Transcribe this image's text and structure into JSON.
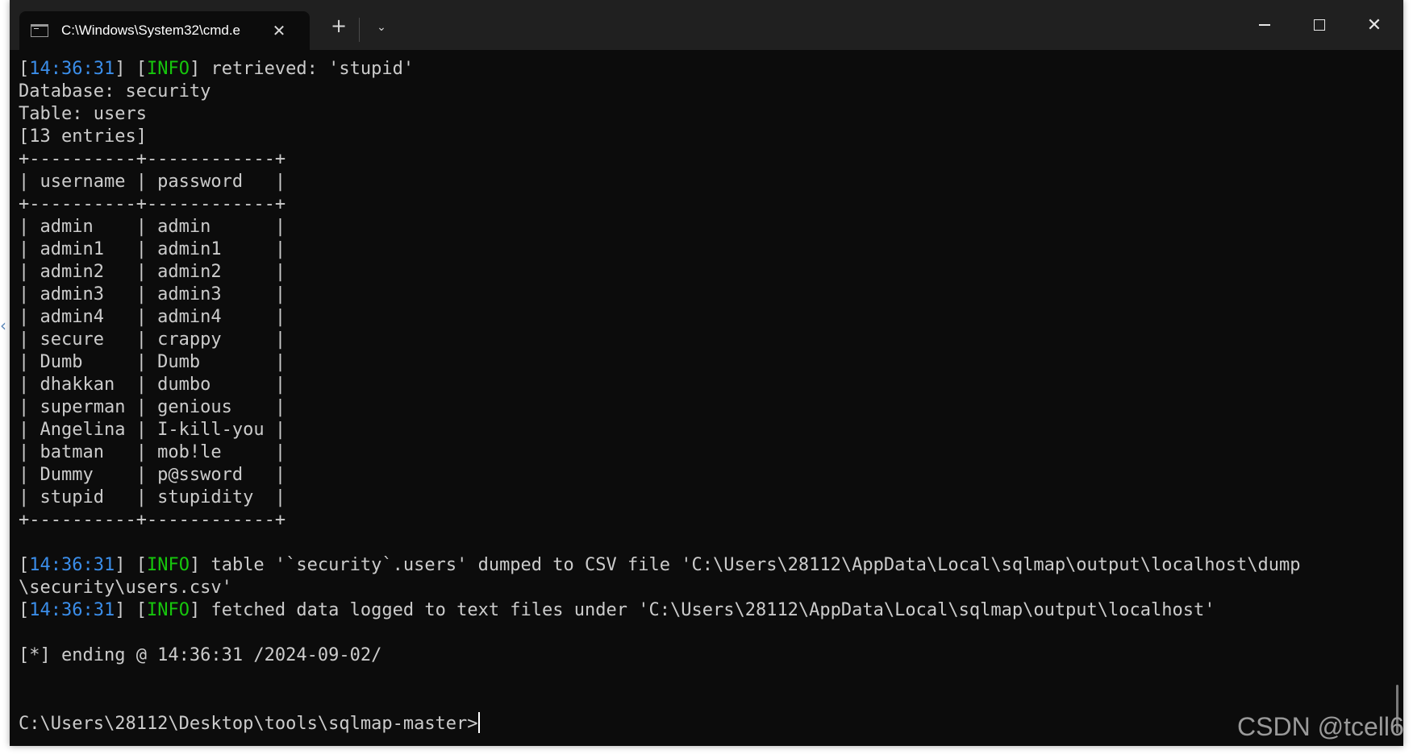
{
  "window": {
    "tab_title": "C:\\Windows\\System32\\cmd.e",
    "tab_close": "✕",
    "new_tab": "+",
    "dropdown": "⌄",
    "min_icon": "minimize-icon",
    "max_icon": "maximize-icon",
    "close_icon": "✕"
  },
  "terminal": {
    "colors": {
      "timestamp": "#3b8eea",
      "info": "#16c60c",
      "text": "#cccccc",
      "background": "#0c0c0c"
    },
    "lines": [
      {
        "ts": "14:36:31",
        "tag": "INFO",
        "text": " retrieved: 'stupid'"
      },
      {
        "text": "Database: security"
      },
      {
        "text": "Table: users"
      },
      {
        "text": "[13 entries]"
      },
      {
        "text": "+----------+------------+"
      },
      {
        "text": "| username | password   |"
      },
      {
        "text": "+----------+------------+"
      },
      {
        "text": "| admin    | admin      |"
      },
      {
        "text": "| admin1   | admin1     |"
      },
      {
        "text": "| admin2   | admin2     |"
      },
      {
        "text": "| admin3   | admin3     |"
      },
      {
        "text": "| admin4   | admin4     |"
      },
      {
        "text": "| secure   | crappy     |"
      },
      {
        "text": "| Dumb     | Dumb       |"
      },
      {
        "text": "| dhakkan  | dumbo      |"
      },
      {
        "text": "| superman | genious    |"
      },
      {
        "text": "| Angelina | I-kill-you |"
      },
      {
        "text": "| batman   | mob!le     |"
      },
      {
        "text": "| Dummy    | p@ssword   |"
      },
      {
        "text": "| stupid   | stupidity  |"
      },
      {
        "text": "+----------+------------+"
      },
      {
        "text": ""
      },
      {
        "ts": "14:36:31",
        "tag": "INFO",
        "text": " table '`security`.users' dumped to CSV file 'C:\\Users\\28112\\AppData\\Local\\sqlmap\\output\\localhost\\dump"
      },
      {
        "text": "\\security\\users.csv'"
      },
      {
        "ts": "14:36:31",
        "tag": "INFO",
        "text": " fetched data logged to text files under 'C:\\Users\\28112\\AppData\\Local\\sqlmap\\output\\localhost'"
      },
      {
        "text": ""
      },
      {
        "text": "[*] ending @ 14:36:31 /2024-09-02/"
      },
      {
        "text": ""
      },
      {
        "text": ""
      }
    ],
    "prompt": "C:\\Users\\28112\\Desktop\\tools\\sqlmap-master>"
  },
  "watermark": "CSDN @tcell6"
}
